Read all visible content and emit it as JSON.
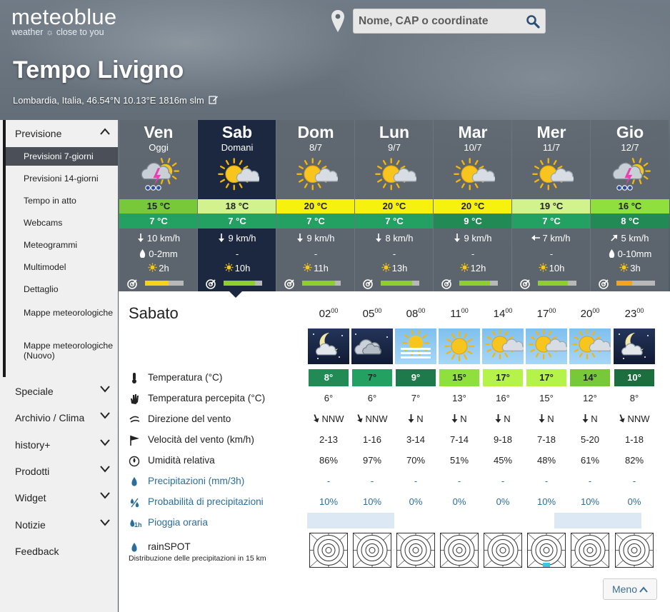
{
  "header": {
    "logo_title": "meteoblue",
    "logo_tagline": "weather ☼ close to you",
    "search_placeholder": "Nome, CAP o coordinate",
    "page_title": "Tempo Livigno",
    "subtitle": "Lombardia, Italia, 46.54°N 10.13°E 1816m slm"
  },
  "sidebar": {
    "section": "Previsione",
    "sub_items": [
      "Previsioni 7-giorni",
      "Previsioni 14-giorni",
      "Tempo in atto",
      "Webcams",
      "Meteogrammi",
      "Multimodel",
      "Dettaglio",
      "Mappe meteorologiche",
      "Mappe meteorologiche (Nuovo)"
    ],
    "active_sub": "Previsioni 7-giorni",
    "sections": [
      "Speciale",
      "Archivio / Clima",
      "history+",
      "Prodotti",
      "Widget",
      "Notizie",
      "Feedback"
    ]
  },
  "days": [
    {
      "name": "Ven",
      "date": "Oggi",
      "icon": "sun-cloud-thunder-icon",
      "tmax": "15 °C",
      "tmax_color": "#77c93a",
      "tmin": "7 °C",
      "tmin_color": "#23a163",
      "wind": "10 km/h",
      "wind_dir": "N",
      "precip": "0-2mm",
      "sun": "2h",
      "predict_fill": 0.62,
      "predict_color": "#f3d21a"
    },
    {
      "name": "Sab",
      "date": "Domani",
      "icon": "sun-cloud-icon",
      "tmax": "18 °C",
      "tmax_color": "#d2f28e",
      "tmin": "7 °C",
      "tmin_color": "#23a163",
      "wind": "9 km/h",
      "wind_dir": "N",
      "precip": "-",
      "sun": "10h",
      "predict_fill": 0.82,
      "predict_color": "#8fcf2d"
    },
    {
      "name": "Dom",
      "date": "8/7",
      "icon": "sun-cloud-icon",
      "tmax": "20 °C",
      "tmax_color": "#f7f10e",
      "tmin": "7 °C",
      "tmin_color": "#23a163",
      "wind": "9 km/h",
      "wind_dir": "N",
      "precip": "-",
      "sun": "11h",
      "predict_fill": 0.86,
      "predict_color": "#8fcf2d"
    },
    {
      "name": "Lun",
      "date": "9/7",
      "icon": "sun-cloud-icon",
      "tmax": "20 °C",
      "tmax_color": "#f7f10e",
      "tmin": "7 °C",
      "tmin_color": "#23a163",
      "wind": "8 km/h",
      "wind_dir": "N",
      "precip": "-",
      "sun": "13h",
      "predict_fill": 0.82,
      "predict_color": "#8fcf2d"
    },
    {
      "name": "Mar",
      "date": "10/7",
      "icon": "sun-cloud-icon",
      "tmax": "20 °C",
      "tmax_color": "#f7f10e",
      "tmin": "9 °C",
      "tmin_color": "#218a55",
      "wind": "9 km/h",
      "wind_dir": "N",
      "precip": "-",
      "sun": "12h",
      "predict_fill": 0.8,
      "predict_color": "#8fcf2d"
    },
    {
      "name": "Mer",
      "date": "11/7",
      "icon": "sun-cloud-icon",
      "tmax": "19 °C",
      "tmax_color": "#d2f28e",
      "tmin": "7 °C",
      "tmin_color": "#23a163",
      "wind": "7 km/h",
      "wind_dir": "E",
      "precip": "-",
      "sun": "10h",
      "predict_fill": 0.78,
      "predict_color": "#8fcf2d"
    },
    {
      "name": "Gio",
      "date": "12/7",
      "icon": "sun-cloud-thunder-icon",
      "tmax": "16 °C",
      "tmax_color": "#8fe03d",
      "tmin": "8 °C",
      "tmin_color": "#218a55",
      "wind": "5 km/h",
      "wind_dir": "SW",
      "precip": "0-10mm",
      "sun": "3h",
      "predict_fill": 0.4,
      "predict_color": "#f0a51c"
    }
  ],
  "detail": {
    "title": "Sabato",
    "hours": [
      {
        "h": "02",
        "m": "00",
        "icon": "moon-cloud-icon",
        "night": true
      },
      {
        "h": "05",
        "m": "00",
        "icon": "cloud-icon",
        "night": true
      },
      {
        "h": "08",
        "m": "00",
        "icon": "sun-haze-icon",
        "night": false
      },
      {
        "h": "11",
        "m": "00",
        "icon": "sun-icon",
        "night": false
      },
      {
        "h": "14",
        "m": "00",
        "icon": "sun-cloud-icon",
        "night": false
      },
      {
        "h": "17",
        "m": "00",
        "icon": "sun-cloud-icon",
        "night": false
      },
      {
        "h": "20",
        "m": "00",
        "icon": "sun-cloud-icon",
        "night": false
      },
      {
        "h": "23",
        "m": "00",
        "icon": "moon-cloud-icon",
        "night": true
      }
    ],
    "rows": [
      {
        "label": "Temperatura (°C)",
        "icon": "thermometer-icon",
        "blue": false
      },
      {
        "label": "Temperatura percepita (°C)",
        "icon": "hand-icon",
        "blue": false
      },
      {
        "label": "Direzione del vento",
        "icon": "wind-direction-icon",
        "blue": false
      },
      {
        "label": "Velocità del vento (km/h)",
        "icon": "flag-icon",
        "blue": false
      },
      {
        "label": "Umidità relativa",
        "icon": "humidity-icon",
        "blue": false
      },
      {
        "label": "Precipitazioni (mm/3h)",
        "icon": "drop-icon",
        "blue": true
      },
      {
        "label": "Probabilità di precipitazioni",
        "icon": "percent-drop-icon",
        "blue": true
      },
      {
        "label": "Pioggia oraria",
        "icon": "hourly-rain-icon",
        "blue": true
      },
      {
        "label": "rainSPOT",
        "icon": "drop-icon",
        "blue": false
      }
    ],
    "temperature": [
      "8°",
      "7°",
      "9°",
      "15°",
      "17°",
      "17°",
      "14°",
      "10°"
    ],
    "temperature_colors": [
      "#218a55",
      "#23a163",
      "#1e7a4a",
      "#8fe03d",
      "#b5f24a",
      "#b5f24a",
      "#77c93a",
      "#1d6e3f"
    ],
    "temperature_text_colors": [
      "#fff",
      "#222",
      "#fff",
      "#222",
      "#222",
      "#222",
      "#222",
      "#fff"
    ],
    "felt": [
      "6°",
      "6°",
      "7°",
      "13°",
      "16°",
      "15°",
      "12°",
      "8°"
    ],
    "wind_dir": [
      "NNW",
      "NNW",
      "N",
      "N",
      "N",
      "N",
      "N",
      "NNW"
    ],
    "wind_speed": [
      "2-13",
      "1-16",
      "3-14",
      "7-14",
      "9-18",
      "7-18",
      "5-20",
      "1-18"
    ],
    "humidity": [
      "86%",
      "97%",
      "70%",
      "51%",
      "45%",
      "48%",
      "61%",
      "82%"
    ],
    "precip": [
      "-",
      "-",
      "-",
      "-",
      "-",
      "-",
      "-",
      "-"
    ],
    "precip_prob": [
      "10%",
      "10%",
      "0%",
      "0%",
      "0%",
      "10%",
      "10%",
      "0%"
    ],
    "rainspot_note": "Distribuzione delle precipitazioni in 15 km",
    "menu_label": "Meno"
  }
}
